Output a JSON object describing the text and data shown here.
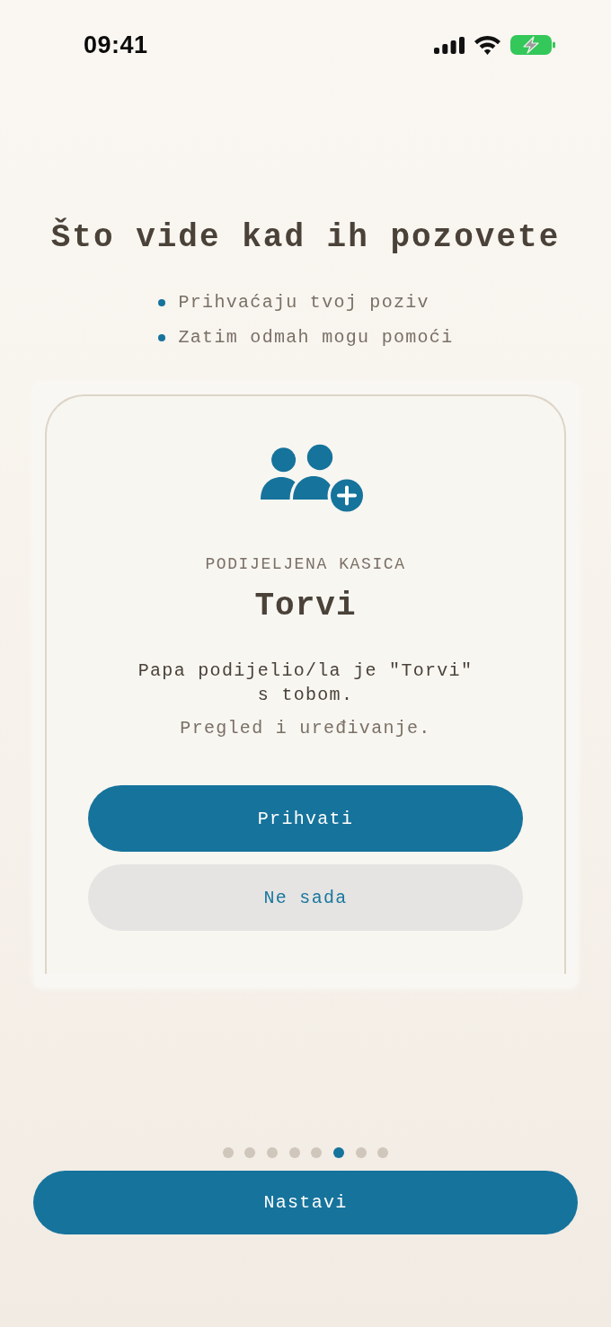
{
  "status_bar": {
    "time": "09:41"
  },
  "title": "Što vide kad ih pozovete",
  "bullets": [
    "Prihvaćaju tvoj poziv",
    "Zatim odmah mogu pomoći"
  ],
  "preview_card": {
    "eyebrow": "PODIJELJENA KASICA",
    "name": "Torvi",
    "message": "Papa podijelio/la je \"Torvi\" s tobom.",
    "note": "Pregled i uređivanje.",
    "buttons": [
      {
        "label": "Prihvati",
        "kind": "primary"
      },
      {
        "label": "Ne sada",
        "kind": "secondary"
      }
    ]
  },
  "pager": [
    {
      "selected": false
    },
    {
      "selected": false
    },
    {
      "selected": false
    },
    {
      "selected": false
    },
    {
      "selected": false
    },
    {
      "selected": true
    },
    {
      "selected": false
    },
    {
      "selected": false
    }
  ],
  "continue_button": {
    "label": "Nastavi"
  }
}
